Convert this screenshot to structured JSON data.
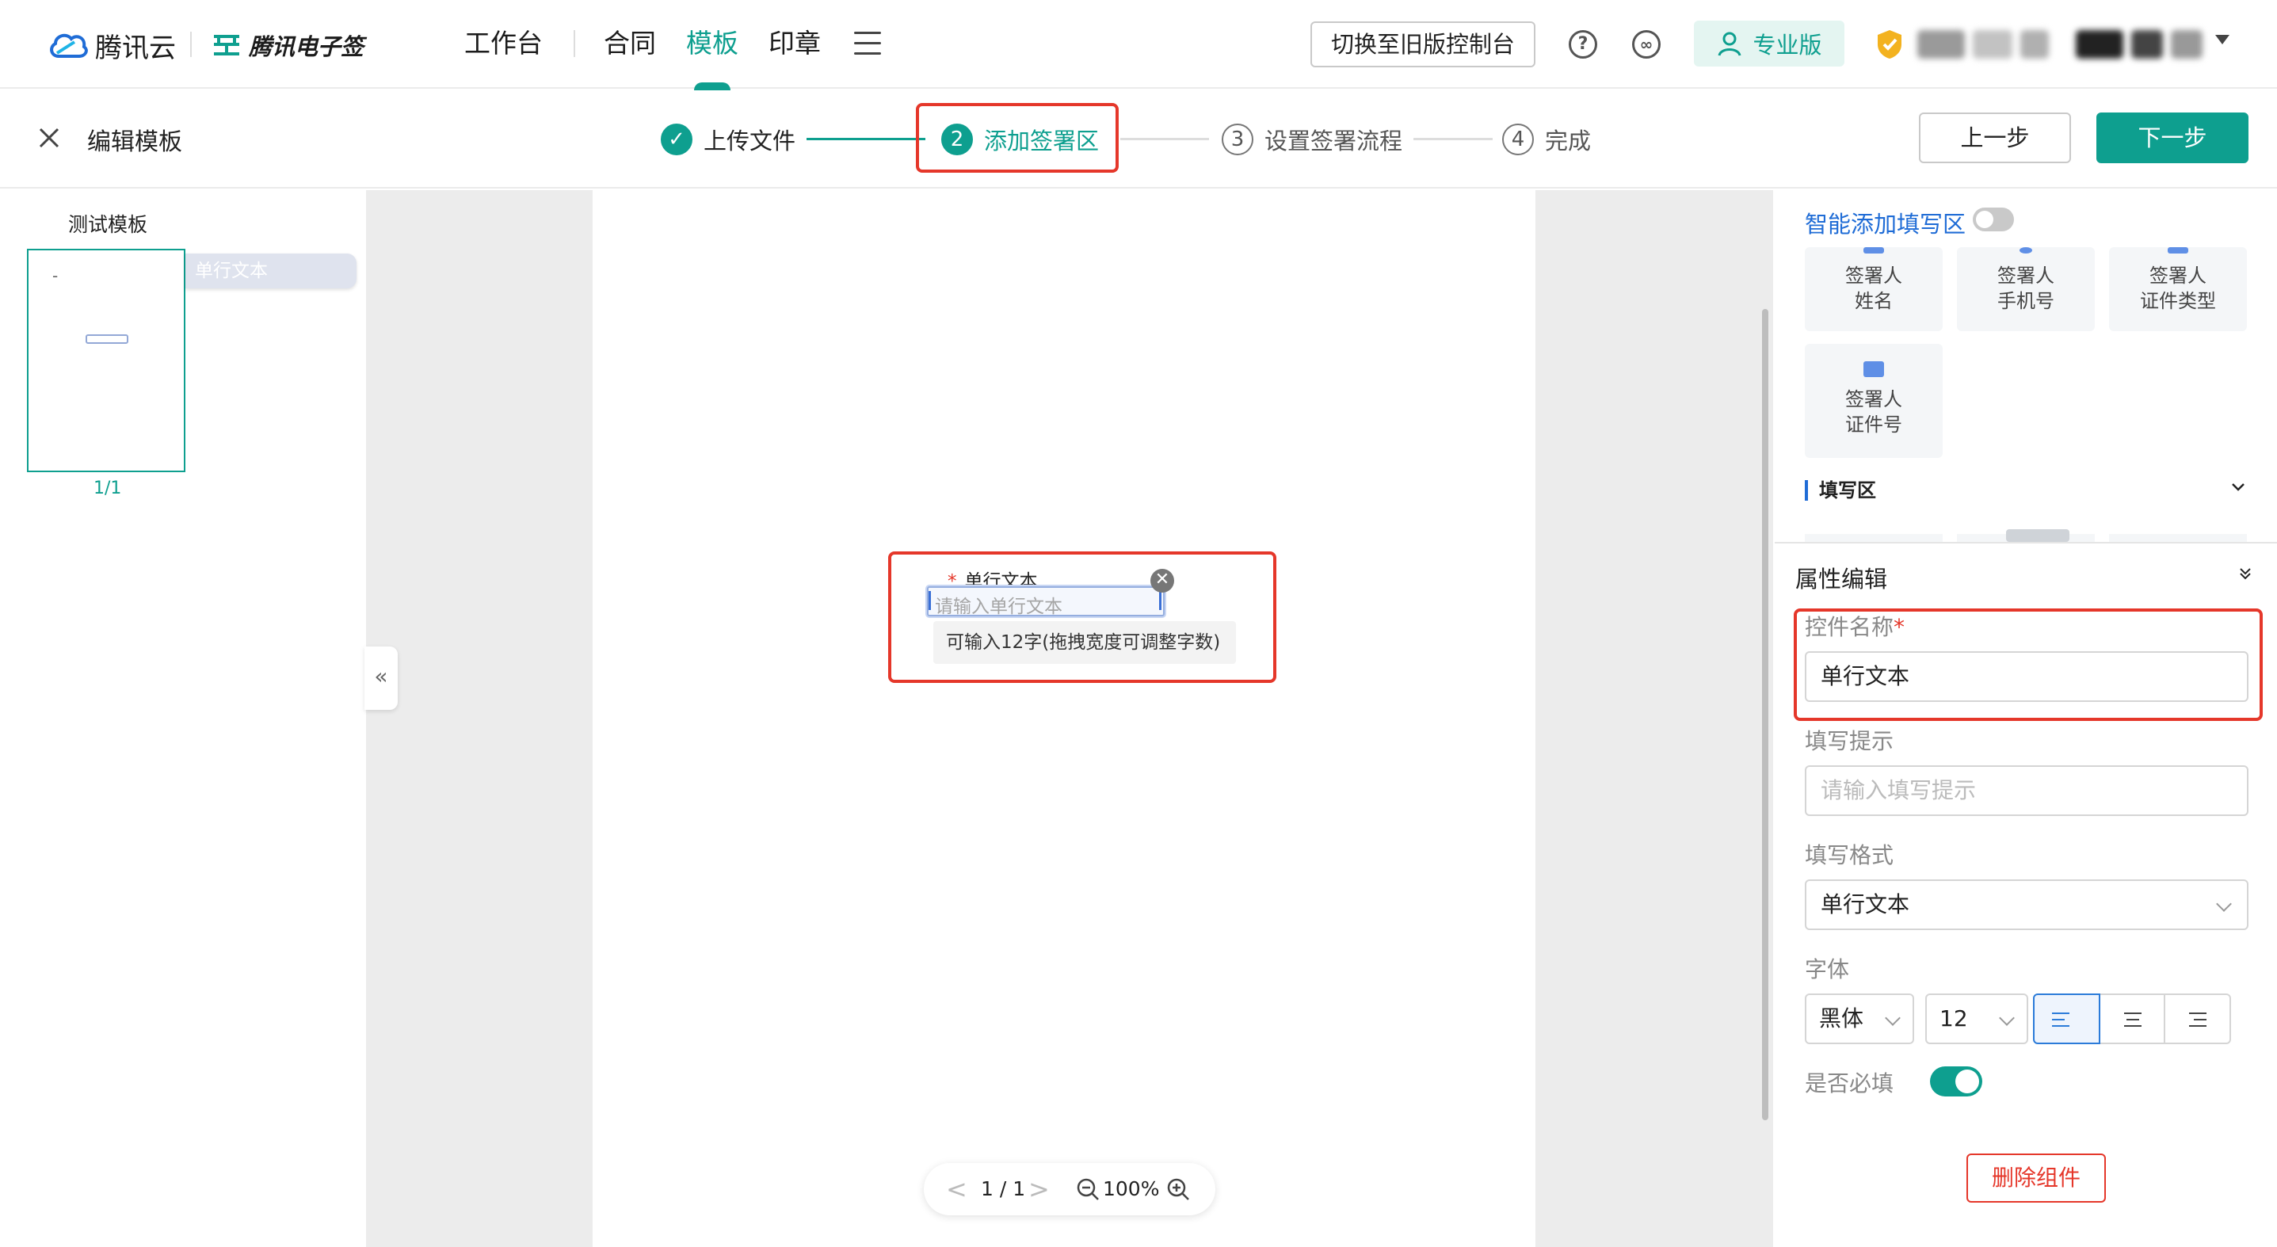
{
  "topnav": {
    "cloud_brand": "腾讯云",
    "esign_brand": "腾讯电子签",
    "nav": [
      "工作台",
      "合同",
      "模板",
      "印章"
    ],
    "active_nav": "模板",
    "switch_console": "切换至旧版控制台",
    "plan_badge": "专业版",
    "icons": [
      "help-icon",
      "link-icon",
      "menu-icon",
      "user-icon",
      "shield-icon"
    ]
  },
  "stepbar": {
    "heading": "编辑模板",
    "steps": [
      {
        "num": "✓",
        "label": "上传文件",
        "state": "done"
      },
      {
        "num": "2",
        "label": "添加签署区",
        "state": "current"
      },
      {
        "num": "3",
        "label": "设置签署流程",
        "state": "todo"
      },
      {
        "num": "4",
        "label": "完成",
        "state": "todo"
      }
    ],
    "prev": "上一步",
    "next": "下一步"
  },
  "left": {
    "template_name": "测试模板",
    "thumb_dash": "-",
    "field_tag": "单行文本",
    "page_indicator": "1/1"
  },
  "canvas": {
    "field_label": "单行文本",
    "required_mark": "*",
    "field_placeholder": "请输入单行文本",
    "field_tip": "可输入12字(拖拽宽度可调整字数)",
    "delete_glyph": "✕",
    "collapse_glyph": "«",
    "pager": {
      "prev": "<",
      "page": "1 / 1",
      "next": ">",
      "zoom": "100%"
    }
  },
  "right": {
    "smart_add": "智能添加填写区",
    "smart_add_enabled": false,
    "controls": [
      {
        "label1": "签署人",
        "label2": "姓名"
      },
      {
        "label1": "签署人",
        "label2": "手机号"
      },
      {
        "label1": "签署人",
        "label2": "证件类型"
      },
      {
        "label1": "签署人",
        "label2": "证件号"
      }
    ],
    "section_fill": "填写区",
    "attr_title": "属性编辑",
    "control_name_label": "控件名称",
    "control_name_required": "*",
    "control_name_value": "单行文本",
    "hint_label": "填写提示",
    "hint_placeholder": "请输入填写提示",
    "format_label": "填写格式",
    "format_value": "单行文本",
    "font_label": "字体",
    "font_family": "黑体",
    "font_size": "12",
    "align_selected": "left",
    "required_label": "是否必填",
    "required_enabled": true,
    "delete_btn": "删除组件"
  },
  "colors": {
    "brand": "#0e9f8f",
    "highlight": "#e5372a",
    "link": "#1f6cd6"
  }
}
